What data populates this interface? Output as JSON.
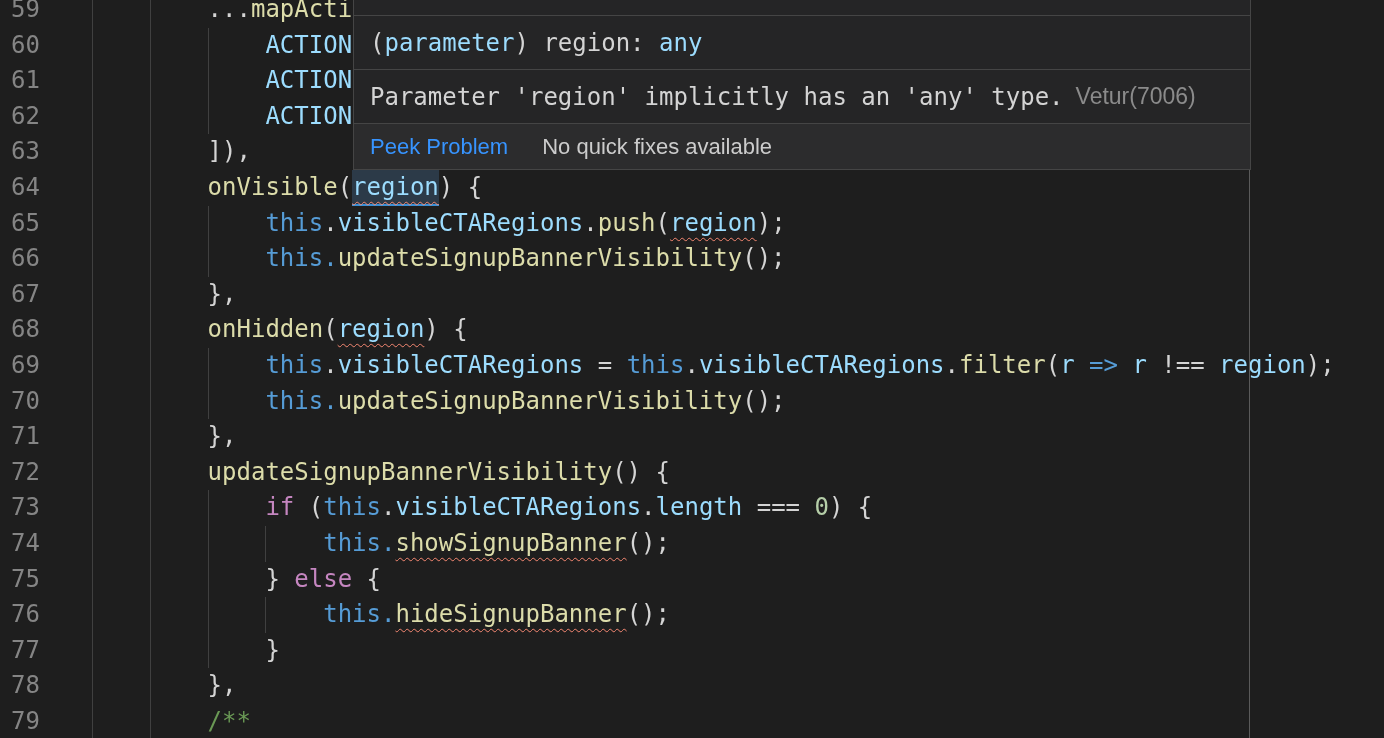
{
  "editor": {
    "lines": [
      {
        "number": "59",
        "tokens": [
          {
            "text": "        ...",
            "kind": "plain",
            "error": false,
            "hovered": false
          },
          {
            "text": "mapActi",
            "kind": "function",
            "error": false,
            "hovered": false
          }
        ]
      },
      {
        "number": "60",
        "tokens": [
          {
            "text": "            ACTION",
            "kind": "constant",
            "error": false,
            "hovered": false
          }
        ]
      },
      {
        "number": "61",
        "tokens": [
          {
            "text": "            ACTION",
            "kind": "constant",
            "error": false,
            "hovered": false
          }
        ]
      },
      {
        "number": "62",
        "tokens": [
          {
            "text": "            ACTION",
            "kind": "constant",
            "error": false,
            "hovered": false
          }
        ]
      },
      {
        "number": "63",
        "tokens": [
          {
            "text": "        ]),",
            "kind": "plain",
            "error": false,
            "hovered": false
          }
        ]
      },
      {
        "number": "64",
        "tokens": [
          {
            "text": "        onVisible",
            "kind": "function",
            "error": false,
            "hovered": false
          },
          {
            "text": "(",
            "kind": "plain",
            "error": false,
            "hovered": false
          },
          {
            "text": "region",
            "kind": "variable",
            "error": true,
            "hovered": true
          },
          {
            "text": ") {",
            "kind": "plain",
            "error": false,
            "hovered": false
          }
        ]
      },
      {
        "number": "65",
        "tokens": [
          {
            "text": "            this",
            "kind": "this",
            "error": false,
            "hovered": false
          },
          {
            "text": ".",
            "kind": "plain",
            "error": false,
            "hovered": false
          },
          {
            "text": "visibleCTARegions",
            "kind": "variable",
            "error": false,
            "hovered": false
          },
          {
            "text": ".",
            "kind": "plain",
            "error": false,
            "hovered": false
          },
          {
            "text": "push",
            "kind": "function",
            "error": false,
            "hovered": false
          },
          {
            "text": "(",
            "kind": "plain",
            "error": false,
            "hovered": false
          },
          {
            "text": "region",
            "kind": "variable",
            "error": true,
            "hovered": false
          },
          {
            "text": ");",
            "kind": "plain",
            "error": false,
            "hovered": false
          }
        ]
      },
      {
        "number": "66",
        "tokens": [
          {
            "text": "            this.",
            "kind": "this",
            "error": false,
            "hovered": false
          },
          {
            "text": "updateSignupBannerVisibility",
            "kind": "function",
            "error": false,
            "hovered": false
          },
          {
            "text": "();",
            "kind": "plain",
            "error": false,
            "hovered": false
          }
        ]
      },
      {
        "number": "67",
        "tokens": [
          {
            "text": "        },",
            "kind": "plain",
            "error": false,
            "hovered": false
          }
        ]
      },
      {
        "number": "68",
        "tokens": [
          {
            "text": "        onHidden",
            "kind": "function",
            "error": false,
            "hovered": false
          },
          {
            "text": "(",
            "kind": "plain",
            "error": false,
            "hovered": false
          },
          {
            "text": "region",
            "kind": "variable",
            "error": true,
            "hovered": false
          },
          {
            "text": ") {",
            "kind": "plain",
            "error": false,
            "hovered": false
          }
        ]
      },
      {
        "number": "69",
        "tokens": [
          {
            "text": "            this",
            "kind": "this",
            "error": false,
            "hovered": false
          },
          {
            "text": ".",
            "kind": "plain",
            "error": false,
            "hovered": false
          },
          {
            "text": "visibleCTARegions",
            "kind": "variable",
            "error": false,
            "hovered": false
          },
          {
            "text": " = ",
            "kind": "plain",
            "error": false,
            "hovered": false
          },
          {
            "text": "this",
            "kind": "this",
            "error": false,
            "hovered": false
          },
          {
            "text": ".",
            "kind": "plain",
            "error": false,
            "hovered": false
          },
          {
            "text": "visibleCTARegions",
            "kind": "variable",
            "error": false,
            "hovered": false
          },
          {
            "text": ".",
            "kind": "plain",
            "error": false,
            "hovered": false
          },
          {
            "text": "filter",
            "kind": "function",
            "error": false,
            "hovered": false
          },
          {
            "text": "(",
            "kind": "plain",
            "error": false,
            "hovered": false
          },
          {
            "text": "r ",
            "kind": "variable",
            "error": false,
            "hovered": false
          },
          {
            "text": "=>",
            "kind": "this",
            "error": false,
            "hovered": false
          },
          {
            "text": " r",
            "kind": "variable",
            "error": false,
            "hovered": false
          },
          {
            "text": " !== ",
            "kind": "plain",
            "error": false,
            "hovered": false
          },
          {
            "text": "region",
            "kind": "variable",
            "error": false,
            "hovered": false
          },
          {
            "text": ");",
            "kind": "plain",
            "error": false,
            "hovered": false
          }
        ]
      },
      {
        "number": "70",
        "tokens": [
          {
            "text": "            this.",
            "kind": "this",
            "error": false,
            "hovered": false
          },
          {
            "text": "updateSignupBannerVisibility",
            "kind": "function",
            "error": false,
            "hovered": false
          },
          {
            "text": "();",
            "kind": "plain",
            "error": false,
            "hovered": false
          }
        ]
      },
      {
        "number": "71",
        "tokens": [
          {
            "text": "        },",
            "kind": "plain",
            "error": false,
            "hovered": false
          }
        ]
      },
      {
        "number": "72",
        "tokens": [
          {
            "text": "        updateSignupBannerVisibility",
            "kind": "function",
            "error": false,
            "hovered": false
          },
          {
            "text": "() {",
            "kind": "plain",
            "error": false,
            "hovered": false
          }
        ]
      },
      {
        "number": "73",
        "tokens": [
          {
            "text": "            if",
            "kind": "control",
            "error": false,
            "hovered": false
          },
          {
            "text": " (",
            "kind": "plain",
            "error": false,
            "hovered": false
          },
          {
            "text": "this",
            "kind": "this",
            "error": false,
            "hovered": false
          },
          {
            "text": ".",
            "kind": "plain",
            "error": false,
            "hovered": false
          },
          {
            "text": "visibleCTARegions",
            "kind": "variable",
            "error": false,
            "hovered": false
          },
          {
            "text": ".",
            "kind": "plain",
            "error": false,
            "hovered": false
          },
          {
            "text": "length",
            "kind": "variable",
            "error": false,
            "hovered": false
          },
          {
            "text": " === ",
            "kind": "plain",
            "error": false,
            "hovered": false
          },
          {
            "text": "0",
            "kind": "number",
            "error": false,
            "hovered": false
          },
          {
            "text": ") {",
            "kind": "plain",
            "error": false,
            "hovered": false
          }
        ]
      },
      {
        "number": "74",
        "tokens": [
          {
            "text": "                this.",
            "kind": "this",
            "error": false,
            "hovered": false
          },
          {
            "text": "showSignupBanner",
            "kind": "function",
            "error": true,
            "hovered": false
          },
          {
            "text": "();",
            "kind": "plain",
            "error": false,
            "hovered": false
          }
        ]
      },
      {
        "number": "75",
        "tokens": [
          {
            "text": "            } ",
            "kind": "plain",
            "error": false,
            "hovered": false
          },
          {
            "text": "else",
            "kind": "control",
            "error": false,
            "hovered": false
          },
          {
            "text": " {",
            "kind": "plain",
            "error": false,
            "hovered": false
          }
        ]
      },
      {
        "number": "76",
        "tokens": [
          {
            "text": "                this.",
            "kind": "this",
            "error": false,
            "hovered": false
          },
          {
            "text": "hideSignupBanner",
            "kind": "function",
            "error": true,
            "hovered": false
          },
          {
            "text": "();",
            "kind": "plain",
            "error": false,
            "hovered": false
          }
        ]
      },
      {
        "number": "77",
        "tokens": [
          {
            "text": "            }",
            "kind": "plain",
            "error": false,
            "hovered": false
          }
        ]
      },
      {
        "number": "78",
        "tokens": [
          {
            "text": "        },",
            "kind": "plain",
            "error": false,
            "hovered": false
          }
        ]
      },
      {
        "number": "79",
        "tokens": [
          {
            "text": "        /**",
            "kind": "comment",
            "error": false,
            "hovered": false
          }
        ]
      }
    ]
  },
  "hover": {
    "signature": [
      {
        "text": "(",
        "kind": "plain"
      },
      {
        "text": "parameter",
        "kind": "variable"
      },
      {
        "text": ") region: ",
        "kind": "plain"
      },
      {
        "text": "any",
        "kind": "variable"
      }
    ],
    "message": "Parameter 'region' implicitly has an 'any' type.",
    "source": "Vetur(7006)",
    "action": "Peek Problem",
    "status": "No quick fixes available"
  }
}
